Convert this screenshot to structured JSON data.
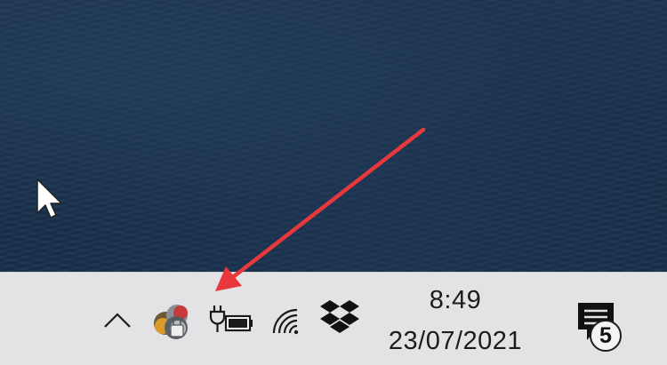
{
  "taskbar": {
    "show_hidden_icons_glyph": "^",
    "tray_icons": [
      {
        "name": "app-tray-icon",
        "icon": "colorful-circles-icon"
      },
      {
        "name": "battery-charging",
        "icon": "plug-battery-icon"
      },
      {
        "name": "network",
        "icon": "wifi-icon"
      },
      {
        "name": "dropbox",
        "icon": "dropbox-icon"
      }
    ],
    "clock": {
      "time": "8:49",
      "date": "23/07/2021"
    },
    "action_center": {
      "icon": "chat-bubble-icon",
      "notification_count": "5"
    }
  },
  "annotation": {
    "arrow_color": "#e8383c"
  },
  "colors": {
    "taskbar_bg": "#e3e3e6",
    "desktop_bg": "#19304b",
    "text": "#1c1c1c"
  }
}
